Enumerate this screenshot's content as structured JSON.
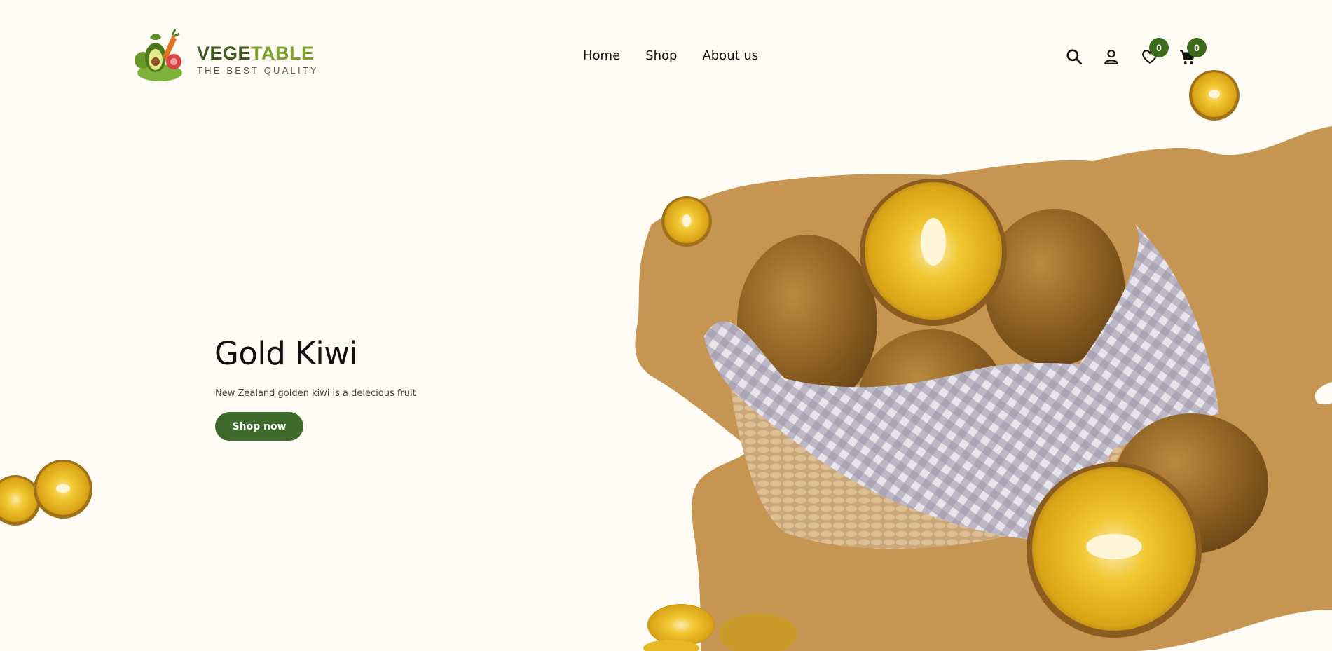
{
  "brand": {
    "name_part1": "VEGE",
    "name_part2": "TABLE",
    "tagline": "THE BEST QUALITY"
  },
  "nav": [
    {
      "label": "Home"
    },
    {
      "label": "Shop"
    },
    {
      "label": "About us"
    }
  ],
  "header_icons": {
    "search": "search-icon",
    "account": "user-icon",
    "wishlist": "heart-icon",
    "cart": "cart-icon",
    "wishlist_count": "0",
    "cart_count": "0"
  },
  "hero": {
    "title": "Gold Kiwi",
    "description": "New Zealand golden kiwi is a delecious fruit",
    "cta_label": "Shop now"
  },
  "colors": {
    "background": "#fefcf5",
    "brand_dark": "#3c5a1d",
    "brand_light": "#7aa32b",
    "badge": "#3a6a1a",
    "button": "#3e6a2c",
    "blob": "#c79552"
  }
}
